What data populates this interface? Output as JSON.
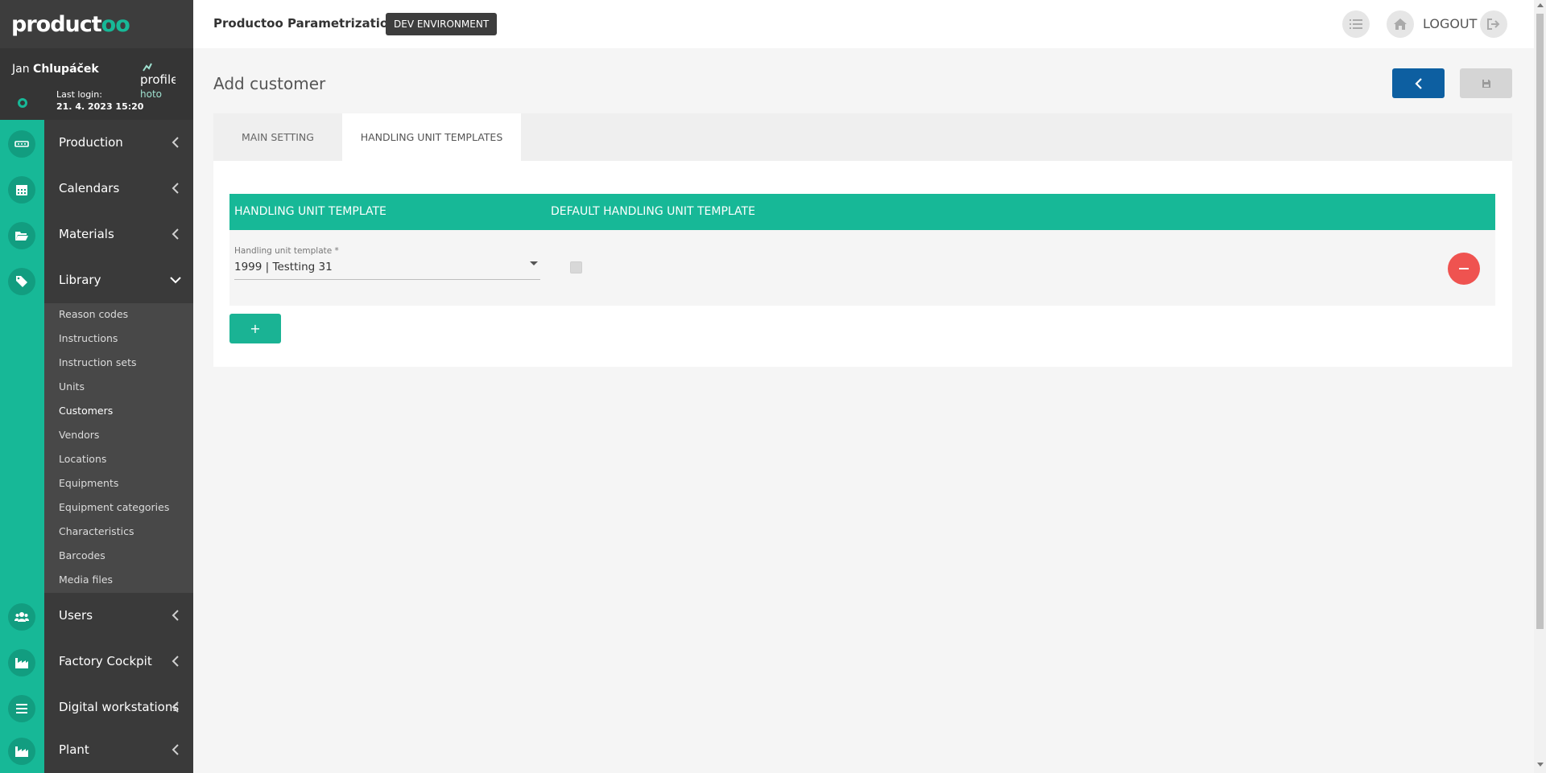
{
  "brand": {
    "logo_main": "product",
    "logo_accent": "oo",
    "accent_color": "#17b897",
    "sidebar_color": "#3a3a3a"
  },
  "user": {
    "first_name": "Jan",
    "last_name": "Chlupáček",
    "last_login_label": "Last login:",
    "last_login_value": "21. 4. 2023 15:20",
    "profile_alt": "profile",
    "profile_alt_2": "hoto"
  },
  "nav": {
    "production": "Production",
    "calendars": "Calendars",
    "materials": "Materials",
    "library": "Library",
    "users": "Users",
    "factory_cockpit": "Factory Cockpit",
    "digital_workstations": "Digital workstations",
    "plant": "Plant"
  },
  "library_items": {
    "reason_codes": "Reason codes",
    "instructions": "Instructions",
    "instruction_sets": "Instruction sets",
    "units": "Units",
    "customers": "Customers",
    "vendors": "Vendors",
    "locations": "Locations",
    "equipments": "Equipments",
    "equipment_categories": "Equipment categories",
    "characteristics": "Characteristics",
    "barcodes": "Barcodes",
    "media_files": "Media files"
  },
  "topbar": {
    "app_title": "Productoo Parametrization",
    "env_badge": "DEV ENVIRONMENT",
    "logout_label": "LOGOUT"
  },
  "page": {
    "title": "Add customer"
  },
  "tabs": {
    "main_setting": "MAIN SETTING",
    "handling_unit_templates": "HANDLING UNIT TEMPLATES"
  },
  "table": {
    "col_template": "HANDLING UNIT TEMPLATE",
    "col_default": "DEFAULT HANDLING UNIT TEMPLATE",
    "field_label": "Handling unit template *",
    "field_value": "1999 | Testting 31"
  },
  "buttons": {
    "add_row": "+"
  }
}
